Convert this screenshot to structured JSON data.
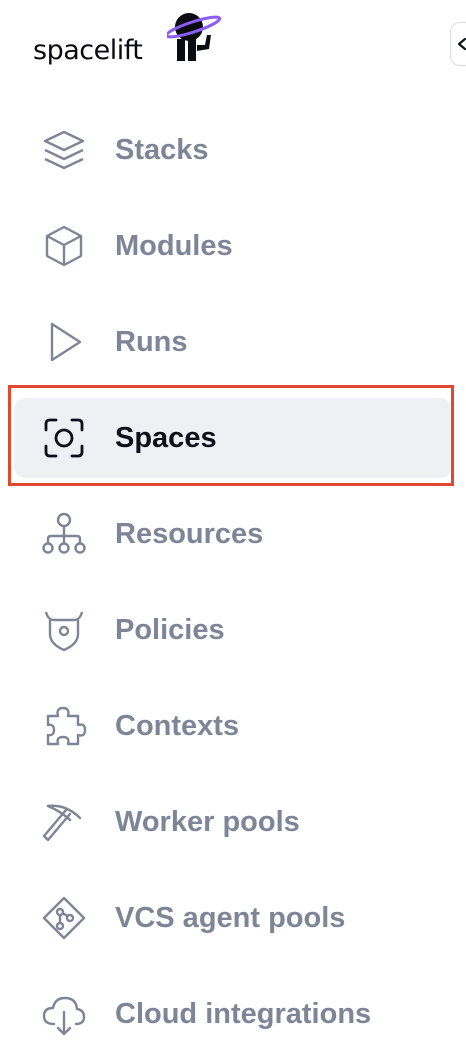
{
  "brand": {
    "name": "spacelift"
  },
  "colors": {
    "muted": "#7e8596",
    "active": "#0e1019",
    "active_bg": "#eff0f4",
    "highlight": "#e2482e",
    "accent": "#8b5cf6"
  },
  "nav": {
    "items": [
      {
        "label": "Stacks",
        "icon": "stacks-icon",
        "active": false
      },
      {
        "label": "Modules",
        "icon": "cube-icon",
        "active": false
      },
      {
        "label": "Runs",
        "icon": "play-icon",
        "active": false
      },
      {
        "label": "Spaces",
        "icon": "focus-circle-icon",
        "active": true
      },
      {
        "label": "Resources",
        "icon": "hierarchy-icon",
        "active": false
      },
      {
        "label": "Policies",
        "icon": "shield-horns-icon",
        "active": false
      },
      {
        "label": "Contexts",
        "icon": "puzzle-icon",
        "active": false
      },
      {
        "label": "Worker pools",
        "icon": "pickaxe-icon",
        "active": false
      },
      {
        "label": "VCS agent pools",
        "icon": "git-diamond-icon",
        "active": false
      },
      {
        "label": "Cloud integrations",
        "icon": "cloud-upload-icon",
        "active": false
      }
    ]
  }
}
